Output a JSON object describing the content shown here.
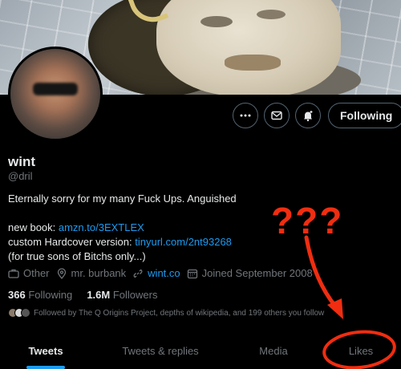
{
  "profile": {
    "name": "wint",
    "handle": "@dril",
    "bio_line1": "Eternally sorry for my many Fuck Ups. Anguished",
    "book_prefix": "new book: ",
    "book_link": "amzn.to/3EXTLEX",
    "hardcover_prefix": "custom Hardcover version: ",
    "hardcover_link": "tinyurl.com/2nt93268",
    "bio_last": "(for true sons of Bitchs only...)"
  },
  "meta": {
    "category": "Other",
    "location": "mr. burbank",
    "website": "wint.co",
    "joined": "Joined September 2008"
  },
  "stats": {
    "following_count": "366",
    "following_label": "Following",
    "followers_count": "1.6M",
    "followers_label": "Followers"
  },
  "followed_by": "Followed by The Q Origins Project, depths of wikipedia, and 199 others you follow",
  "actions": {
    "following_label": "Following"
  },
  "tabs": [
    {
      "label": "Tweets",
      "active": true
    },
    {
      "label": "Tweets & replies",
      "active": false
    },
    {
      "label": "Media",
      "active": false
    },
    {
      "label": "Likes",
      "active": false
    }
  ],
  "annotation": {
    "text": "???",
    "color": "#f02d10"
  },
  "colors": {
    "link": "#1d9bf0",
    "muted": "#71767b",
    "text": "#e7e9ea",
    "background": "#000000"
  },
  "icons": [
    "more-icon",
    "mail-icon",
    "bell-plus-icon",
    "briefcase-icon",
    "location-icon",
    "link-icon",
    "calendar-icon"
  ]
}
